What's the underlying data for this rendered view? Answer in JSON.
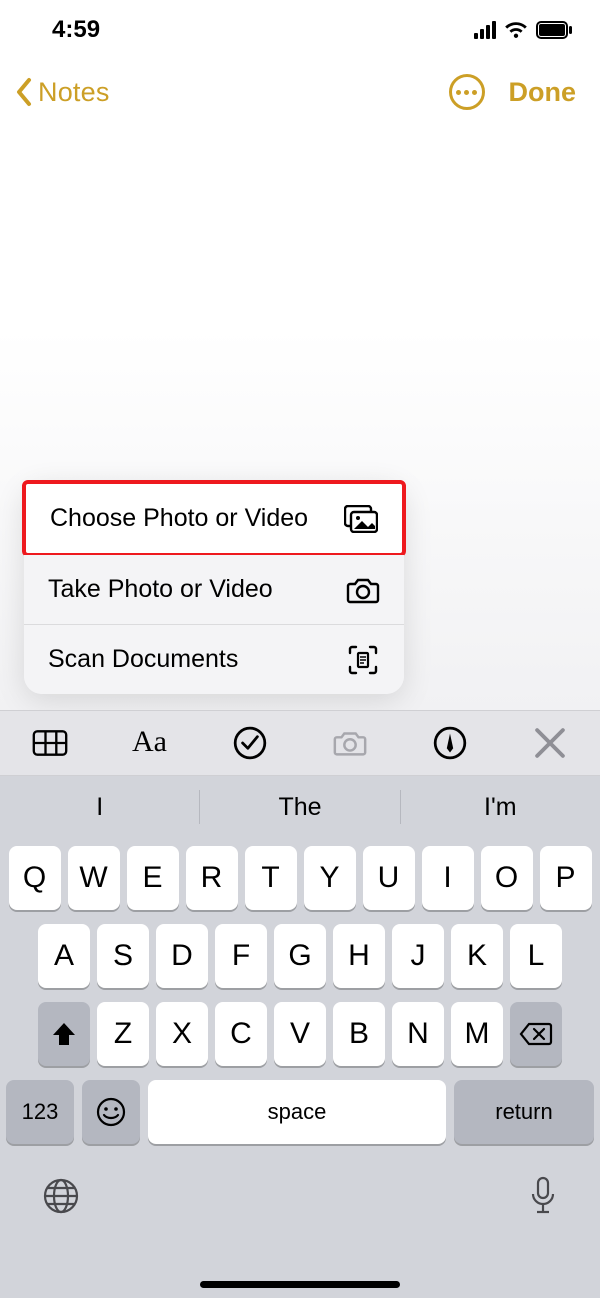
{
  "status": {
    "time": "4:59"
  },
  "nav": {
    "back_label": "Notes",
    "done_label": "Done"
  },
  "popup": {
    "items": [
      {
        "label": "Choose Photo or Video",
        "icon": "photo-stack",
        "highlight": true
      },
      {
        "label": "Take Photo or Video",
        "icon": "camera",
        "highlight": false
      },
      {
        "label": "Scan Documents",
        "icon": "doc-scan",
        "highlight": false
      }
    ]
  },
  "format_bar": {
    "icons": [
      "table",
      "text-format",
      "checkmark-circle",
      "camera",
      "pen-circle",
      "close"
    ]
  },
  "predictions": [
    "I",
    "The",
    "I'm"
  ],
  "keyboard": {
    "row1": [
      "Q",
      "W",
      "E",
      "R",
      "T",
      "Y",
      "U",
      "I",
      "O",
      "P"
    ],
    "row2": [
      "A",
      "S",
      "D",
      "F",
      "G",
      "H",
      "J",
      "K",
      "L"
    ],
    "row3": [
      "Z",
      "X",
      "C",
      "V",
      "B",
      "N",
      "M"
    ],
    "numbers_label": "123",
    "space_label": "space",
    "return_label": "return"
  }
}
